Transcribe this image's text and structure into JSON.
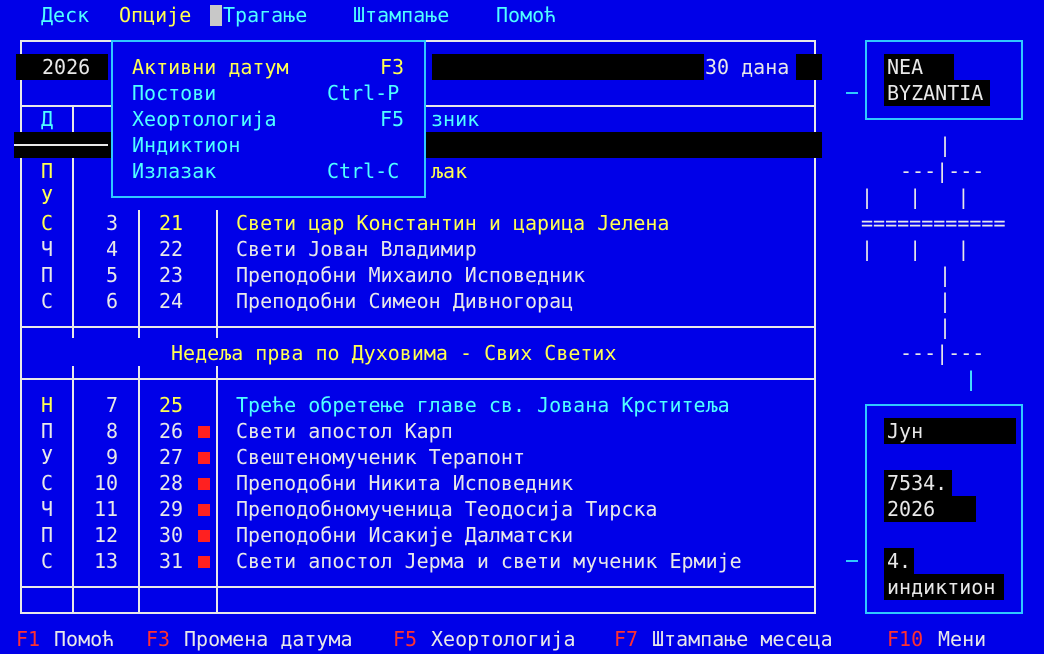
{
  "menubar": [
    "Деск",
    "Опције",
    "Трагање",
    "Штампање",
    "Помоћ"
  ],
  "header": {
    "year": "2026",
    "period": "30 дана"
  },
  "col_header": {
    "weekday": "Д",
    "saint": "зник"
  },
  "upper_rows": [
    {
      "wd": "П",
      "civ": "",
      "jul": "",
      "title": "љак",
      "wd_color": "y",
      "title_color": "y"
    },
    {
      "wd": "У",
      "civ": "",
      "jul": "",
      "title": "",
      "wd_color": "y",
      "title_color": "w"
    },
    {
      "wd": "С",
      "civ": "3",
      "jul": "21",
      "title": "Свети цар Константин и царица Јелена",
      "wd_color": "y",
      "title_color": "y"
    },
    {
      "wd": "Ч",
      "civ": "4",
      "jul": "22",
      "title": "Свети Јован Владимир",
      "wd_color": "w",
      "title_color": "w"
    },
    {
      "wd": "П",
      "civ": "5",
      "jul": "23",
      "title": "Преподобни Михаило Исповедник",
      "wd_color": "w",
      "title_color": "w"
    },
    {
      "wd": "С",
      "civ": "6",
      "jul": "24",
      "title": "Преподобни Симеон Дивногорац",
      "wd_color": "w",
      "title_color": "w"
    }
  ],
  "week_title": "Недеља прва по Духовима - Свих Светих",
  "lower_rows": [
    {
      "wd": "Н",
      "civ": "7",
      "jul": "25",
      "title": "Треће обретење главе св. Јована Крститеља",
      "wd_color": "y",
      "jul_color": "y",
      "title_color": "c",
      "fast": false
    },
    {
      "wd": "П",
      "civ": "8",
      "jul": "26",
      "title": "Свети апостол Карп",
      "wd_color": "w",
      "jul_color": "w",
      "title_color": "w",
      "fast": true
    },
    {
      "wd": "У",
      "civ": "9",
      "jul": "27",
      "title": "Свештеномученик Терапонт",
      "wd_color": "w",
      "jul_color": "w",
      "title_color": "w",
      "fast": true
    },
    {
      "wd": "С",
      "civ": "10",
      "jul": "28",
      "title": "Преподобни Никита Исповедник",
      "wd_color": "w",
      "jul_color": "w",
      "title_color": "w",
      "fast": true
    },
    {
      "wd": "Ч",
      "civ": "11",
      "jul": "29",
      "title": "Преподобномученица Теодосија Тирска",
      "wd_color": "w",
      "jul_color": "w",
      "title_color": "w",
      "fast": true
    },
    {
      "wd": "П",
      "civ": "12",
      "jul": "30",
      "title": "Преподобни Исакије Далматски",
      "wd_color": "w",
      "jul_color": "w",
      "title_color": "w",
      "fast": true
    },
    {
      "wd": "С",
      "civ": "13",
      "jul": "31",
      "title": "Свети апостол Јерма и свети мученик Ермије",
      "wd_color": "w",
      "jul_color": "w",
      "title_color": "w",
      "fast": true
    }
  ],
  "dropdown": [
    {
      "label": "Активни датум",
      "shortcut": "F3",
      "active": true
    },
    {
      "label": "Постови",
      "shortcut": "Ctrl-P",
      "active": false
    },
    {
      "label": "Хеортологија",
      "shortcut": "F5",
      "active": false
    },
    {
      "label": "Индиктион",
      "shortcut": "",
      "active": false
    },
    {
      "label": "Излазак",
      "shortcut": "Ctrl-C",
      "active": false
    }
  ],
  "logo": {
    "line1": "NEA",
    "line2": "BYZANTIA"
  },
  "cross_art": [
    "|",
    "---|---",
    "|   |   |",
    "============",
    "|   |   |",
    "|",
    "|",
    "|",
    "---|---",
    "|"
  ],
  "info": {
    "month": "Јун",
    "year_byz": "7534.",
    "year_ad": "2026",
    "indiction_num": "4.",
    "indiction_label": "индиктион"
  },
  "footer": [
    {
      "key": "F1",
      "label": "Помоћ"
    },
    {
      "key": "F3",
      "label": "Промена датума"
    },
    {
      "key": "F5",
      "label": "Хеортологија"
    },
    {
      "key": "F7",
      "label": "Штампање месеца"
    },
    {
      "key": "F10",
      "label": "Мени"
    }
  ],
  "colors": {
    "background": "#0000e8",
    "text": "#e8e8e8",
    "highlight": "#ffff50",
    "accent": "#50ffff",
    "hotkey": "#ff3030",
    "border": "#30c8ff"
  }
}
